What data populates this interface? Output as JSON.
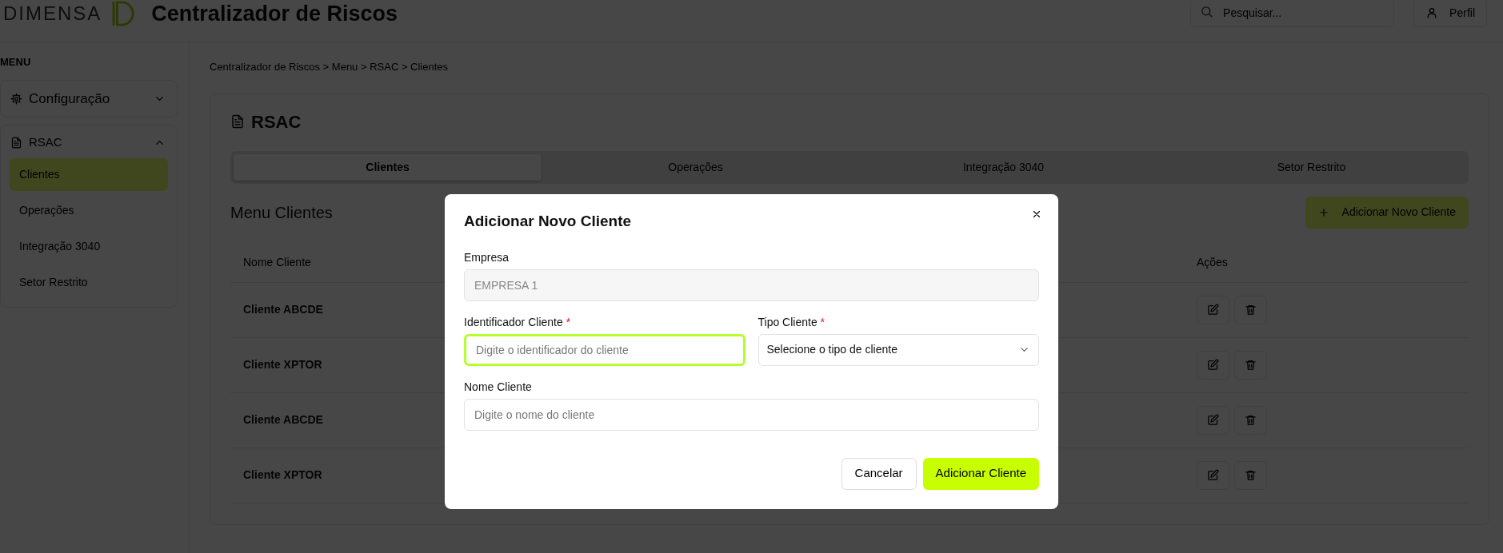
{
  "header": {
    "brand": "DIMENSA",
    "title": "Centralizador de Riscos",
    "search": {
      "placeholder": "Pesquisar..."
    },
    "profile_button": "Perfil"
  },
  "sidebar": {
    "heading": "MENU",
    "groups": [
      {
        "label": "Configuração",
        "expanded": false
      },
      {
        "label": "RSAC",
        "expanded": true,
        "children": [
          {
            "label": "Clientes",
            "selected": true
          },
          {
            "label": "Operações",
            "selected": false
          },
          {
            "label": "Integração 3040",
            "selected": false
          },
          {
            "label": "Setor Restrito",
            "selected": false
          }
        ]
      }
    ]
  },
  "breadcrumb": "Centralizador de Riscos > Menu > RSAC > Clientes",
  "page": {
    "title": "RSAC",
    "tabs": [
      {
        "label": "Clientes",
        "selected": true
      },
      {
        "label": "Operações",
        "selected": false
      },
      {
        "label": "Integração 3040",
        "selected": false
      },
      {
        "label": "Setor Restrito",
        "selected": false
      }
    ],
    "section_title": "Menu Clientes",
    "add_button": "Adicionar Novo Cliente",
    "table": {
      "columns": [
        "Nome Cliente",
        "Ações"
      ],
      "rows": [
        {
          "name": "Cliente ABCDE"
        },
        {
          "name": "Cliente XPTOR"
        },
        {
          "name": "Cliente ABCDE"
        },
        {
          "name": "Cliente XPTOR"
        }
      ]
    }
  },
  "modal": {
    "title": "Adicionar Novo Cliente",
    "rows": [
      [
        {
          "kind": "readonly",
          "label": "Empresa",
          "value": "EMPRESA 1"
        }
      ],
      [
        {
          "kind": "text",
          "label": "Identificador Cliente",
          "required_mark": "*",
          "focused": true,
          "placeholder": "Digite o identificador do cliente"
        },
        {
          "kind": "select",
          "label": "Tipo Cliente",
          "required_mark": "*",
          "value": "Selecione o tipo de cliente"
        }
      ],
      [
        {
          "kind": "text",
          "label": "Nome Cliente",
          "focused": false,
          "placeholder": "Digite o nome do cliente"
        }
      ]
    ],
    "buttons": [
      {
        "label": "Cancelar",
        "kind": "secondary"
      },
      {
        "label": "Adicionar Cliente",
        "kind": "primary"
      }
    ]
  }
}
